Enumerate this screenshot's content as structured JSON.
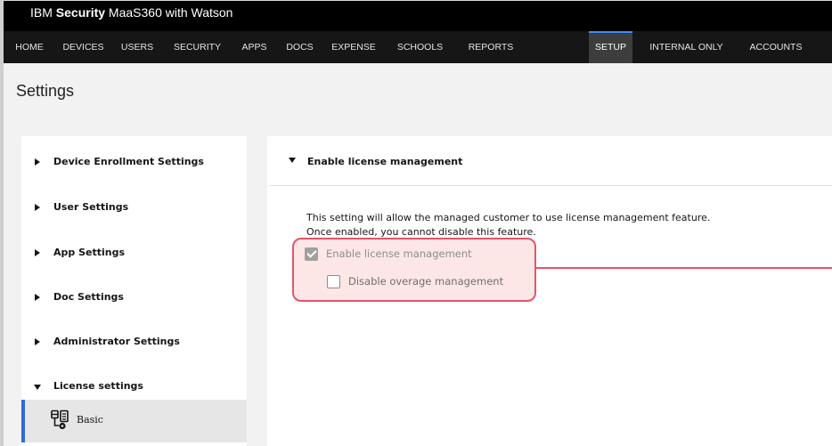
{
  "app": {
    "brand_prefix": "IBM ",
    "brand_bold": "Security",
    "brand_suffix": " MaaS360 with Watson"
  },
  "nav": {
    "items": [
      "HOME",
      "DEVICES",
      "USERS",
      "SECURITY",
      "APPS",
      "DOCS",
      "EXPENSE",
      "SCHOOLS",
      "REPORTS",
      "SETUP",
      "INTERNAL ONLY",
      "ACCOUNTS"
    ],
    "active": "SETUP"
  },
  "page": {
    "title": "Settings"
  },
  "sidebar": {
    "items": [
      "Device Enrollment Settings",
      "User Settings",
      "App Settings",
      "Doc Settings",
      "Administrator Settings",
      "License settings"
    ],
    "active_sub": "Basic"
  },
  "section": {
    "title": "Enable license management",
    "description_line1": "This setting will allow the managed customer to use license management feature.",
    "description_line2": "Once enabled, you cannot disable this feature.",
    "checkbox_enable": {
      "label": "Enable license management",
      "checked": true,
      "disabled": true
    },
    "checkbox_overage": {
      "label": "Disable overage management",
      "checked": false,
      "disabled": true
    }
  },
  "icons": {
    "basic": "settings-document-icon",
    "collapsed": "caret-right-icon",
    "expanded": "caret-down-icon"
  },
  "colors": {
    "highlight_border": "#e0566a",
    "highlight_fill": "#fde6e6",
    "active_accent": "#2f6bd8"
  }
}
